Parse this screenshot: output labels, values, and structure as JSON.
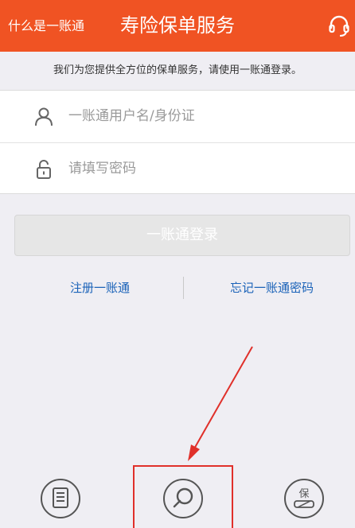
{
  "header": {
    "back_label": "什么是一账通",
    "title": "寿险保单服务",
    "support_icon": "headset-icon",
    "background": "#f05323"
  },
  "notice": "我们为您提供全方位的保单服务，请使用一账通登录。",
  "form": {
    "username_placeholder": "一账通用户名/身份证",
    "password_placeholder": "请填写密码",
    "user_icon": "user-icon",
    "lock_icon": "lock-icon"
  },
  "login_button": "一账通登录",
  "links": {
    "register": "注册一账通",
    "forgot": "忘记一账通密码"
  },
  "bottom_icons": [
    "document-icon",
    "search-icon",
    "policy-icon"
  ],
  "colors": {
    "accent": "#f05323",
    "link": "#1a62b8",
    "annotation": "#e0302a"
  }
}
